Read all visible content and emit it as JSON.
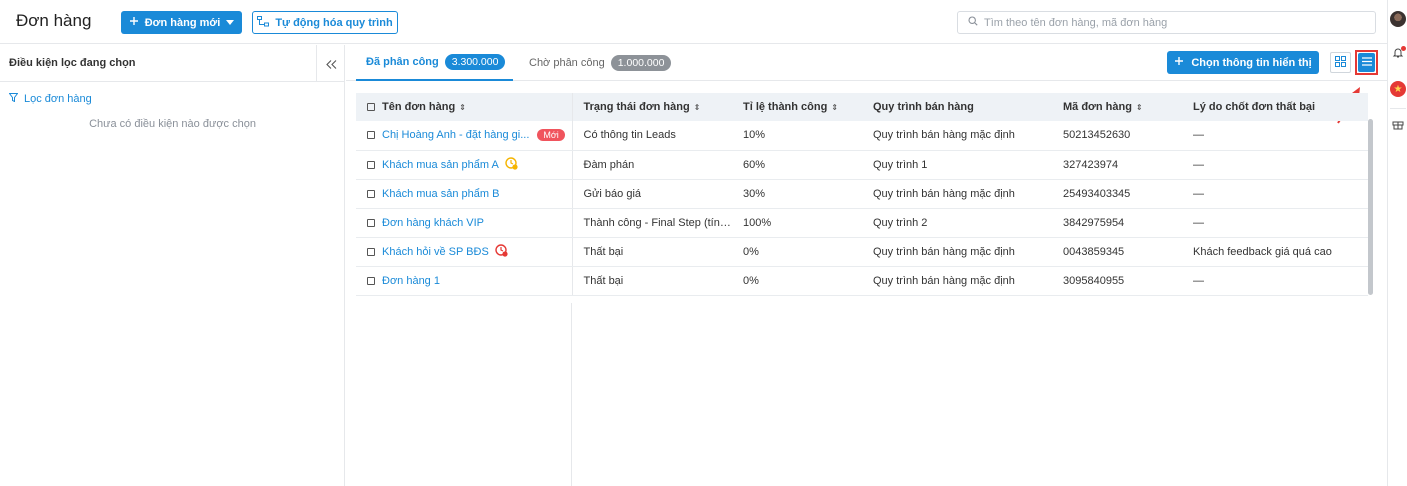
{
  "header": {
    "title": "Đơn hàng",
    "new_order_label": "Đơn hàng mới",
    "automation_label": "Tự động hóa quy trình",
    "search_placeholder": "Tìm theo tên đơn hàng, mã đơn hàng"
  },
  "filter_panel": {
    "title": "Điều kiện lọc đang chọn",
    "filter_link": "Lọc đơn hàng",
    "empty_text": "Chưa có điều kiện nào được chọn"
  },
  "tabs": [
    {
      "label": "Đã phân công",
      "count": "3.300.000",
      "active": true
    },
    {
      "label": "Chờ phân công",
      "count": "1.000.000",
      "active": false
    }
  ],
  "toolbar": {
    "choose_info_label": "Chọn thông tin hiển thị"
  },
  "table": {
    "columns": [
      "Tên đơn hàng",
      "Trạng thái đơn hàng",
      "Tỉ lệ thành công",
      "Quy trình bán hàng",
      "Mã đơn hàng",
      "Lý do chốt đơn thất bại"
    ],
    "rows": [
      {
        "name": "Chị Hoàng Anh - đặt hàng gi...",
        "badge": "Mới",
        "icon": "",
        "status": "Có thông tin Leads",
        "rate": "10%",
        "process": "Quy trình bán hàng mặc định",
        "code": "50213452630",
        "reason": "—"
      },
      {
        "name": "Khách mua sản phẩm A",
        "badge": "",
        "icon": "warning-clock-icon",
        "status": "Đàm phán",
        "rate": "60%",
        "process": "Quy trình 1",
        "code": "327423974",
        "reason": "—"
      },
      {
        "name": "Khách mua sản phẩm B",
        "badge": "",
        "icon": "",
        "status": "Gửi báo giá",
        "rate": "30%",
        "process": "Quy trình bán hàng mặc định",
        "code": "25493403345",
        "reason": "—"
      },
      {
        "name": "Đơn hàng khách VIP",
        "badge": "",
        "icon": "",
        "status": "Thành công - Final Step (tính...",
        "rate": "100%",
        "process": "Quy trình 2",
        "code": "3842975954",
        "reason": "—"
      },
      {
        "name": "Khách hỏi về SP BĐS",
        "badge": "",
        "icon": "overdue-clock-icon",
        "status": "Thất bại",
        "rate": "0%",
        "process": "Quy trình bán hàng mặc định",
        "code": "0043859345",
        "reason": "Khách feedback giá quá cao"
      },
      {
        "name": "Đơn hàng 1",
        "badge": "",
        "icon": "",
        "status": "Thất bại",
        "rate": "0%",
        "process": "Quy trình bán hàng mặc định",
        "code": "3095840955",
        "reason": "—"
      }
    ]
  },
  "colors": {
    "accent": "#1a8ad8",
    "highlight_box": "#e53935",
    "new_badge": "#f0545d",
    "header_bg": "#eef2f6"
  }
}
